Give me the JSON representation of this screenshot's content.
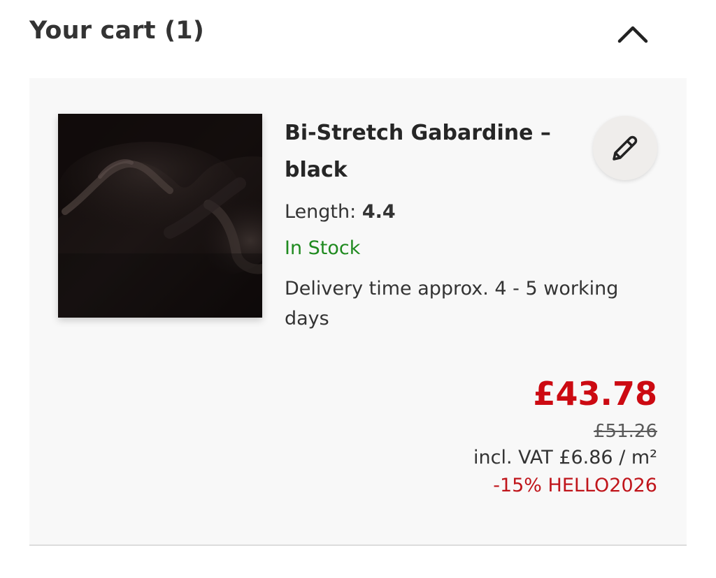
{
  "cart": {
    "title": "Your cart (1)",
    "collapse_icon": "chevron-up-icon"
  },
  "item": {
    "image_icon": "fabric-swatch-image",
    "name": "Bi-Stretch Gabardine – black",
    "length_label": "Length:",
    "length_value": "4.4",
    "stock_status": "In Stock",
    "delivery": "Delivery time approx. 4 - 5 working days",
    "edit_icon": "pencil-icon",
    "price": "£43.78",
    "old_price": "£51.26",
    "vat": "incl. VAT £6.86 / m²",
    "discount": "-15% HELLO2026"
  },
  "colors": {
    "price_red": "#cc0a12",
    "discount_red": "#c0151b",
    "stock_green": "#1f8a1f",
    "text_dark": "#2b2b2b",
    "card_bg": "#f8f8f8"
  }
}
